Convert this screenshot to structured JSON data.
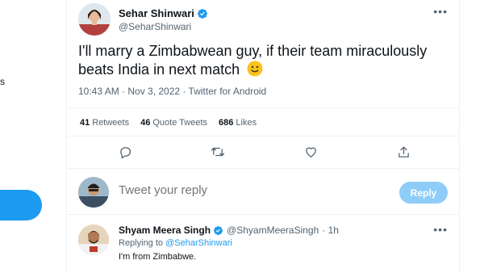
{
  "sidebar": {
    "fragment_text": "s"
  },
  "tweet": {
    "author": {
      "name": "Sehar Shinwari",
      "handle": "@SeharShinwari",
      "verified": true
    },
    "text": "I'll marry a Zimbabwean guy, if their team miraculously beats India in next match",
    "emoji": "slightly-smiling-face-icon",
    "meta": "10:43 AM · Nov 3, 2022 · Twitter for Android",
    "stats": {
      "retweets_count": "41",
      "retweets_label": "Retweets",
      "quotes_count": "46",
      "quotes_label": "Quote Tweets",
      "likes_count": "686",
      "likes_label": "Likes"
    }
  },
  "compose": {
    "placeholder": "Tweet your reply",
    "button_label": "Reply"
  },
  "reply": {
    "name": "Shyam Meera Singh",
    "handle": "@ShyamMeeraSingh",
    "time": "· 1h",
    "replying_prefix": "Replying to",
    "replying_to": "@SeharShinwari",
    "text": "I'm from Zimbabwe."
  },
  "colors": {
    "accent": "#1d9bf0",
    "reply_button_disabled": "#8ecdf8",
    "secondary_text": "#536471"
  }
}
